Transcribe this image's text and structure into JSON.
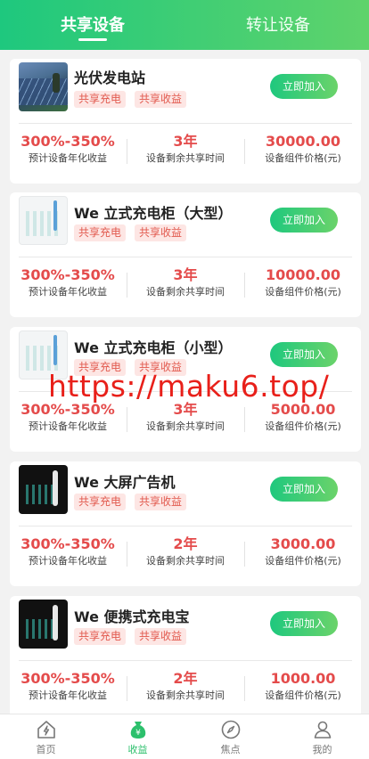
{
  "header": {
    "tabs": [
      {
        "label": "共享设备"
      },
      {
        "label": "转让设备"
      }
    ]
  },
  "join_label": "立即加入",
  "stat_labels": [
    "预计设备年化收益",
    "设备剩余共享时间",
    "设备组件价格(元)"
  ],
  "devices": [
    {
      "title": "光伏发电站",
      "tags": [
        "共享充电",
        "共享收益"
      ],
      "annual_yield": "300%-350%",
      "remaining": "3年",
      "price": "30000.00"
    },
    {
      "title": "We 立式充电柜（大型）",
      "tags": [
        "共享充电",
        "共享收益"
      ],
      "annual_yield": "300%-350%",
      "remaining": "3年",
      "price": "10000.00"
    },
    {
      "title": "We 立式充电柜（小型）",
      "tags": [
        "共享充电",
        "共享收益"
      ],
      "annual_yield": "300%-350%",
      "remaining": "3年",
      "price": "5000.00"
    },
    {
      "title": "We 大屏广告机",
      "tags": [
        "共享充电",
        "共享收益"
      ],
      "annual_yield": "300%-350%",
      "remaining": "2年",
      "price": "3000.00"
    },
    {
      "title": "We 便携式充电宝",
      "tags": [
        "共享充电",
        "共享收益"
      ],
      "annual_yield": "300%-350%",
      "remaining": "2年",
      "price": "1000.00"
    }
  ],
  "watermark": "https://maku6.top/",
  "bottom_nav": [
    {
      "label": "首页",
      "icon": "home-bolt-icon"
    },
    {
      "label": "收益",
      "icon": "money-bag-icon"
    },
    {
      "label": "焦点",
      "icon": "compass-icon"
    },
    {
      "label": "我的",
      "icon": "user-icon"
    }
  ],
  "colors": {
    "accent": "#1ec87e",
    "value_red": "#e44b4b",
    "tag_red": "#e25a4f"
  }
}
